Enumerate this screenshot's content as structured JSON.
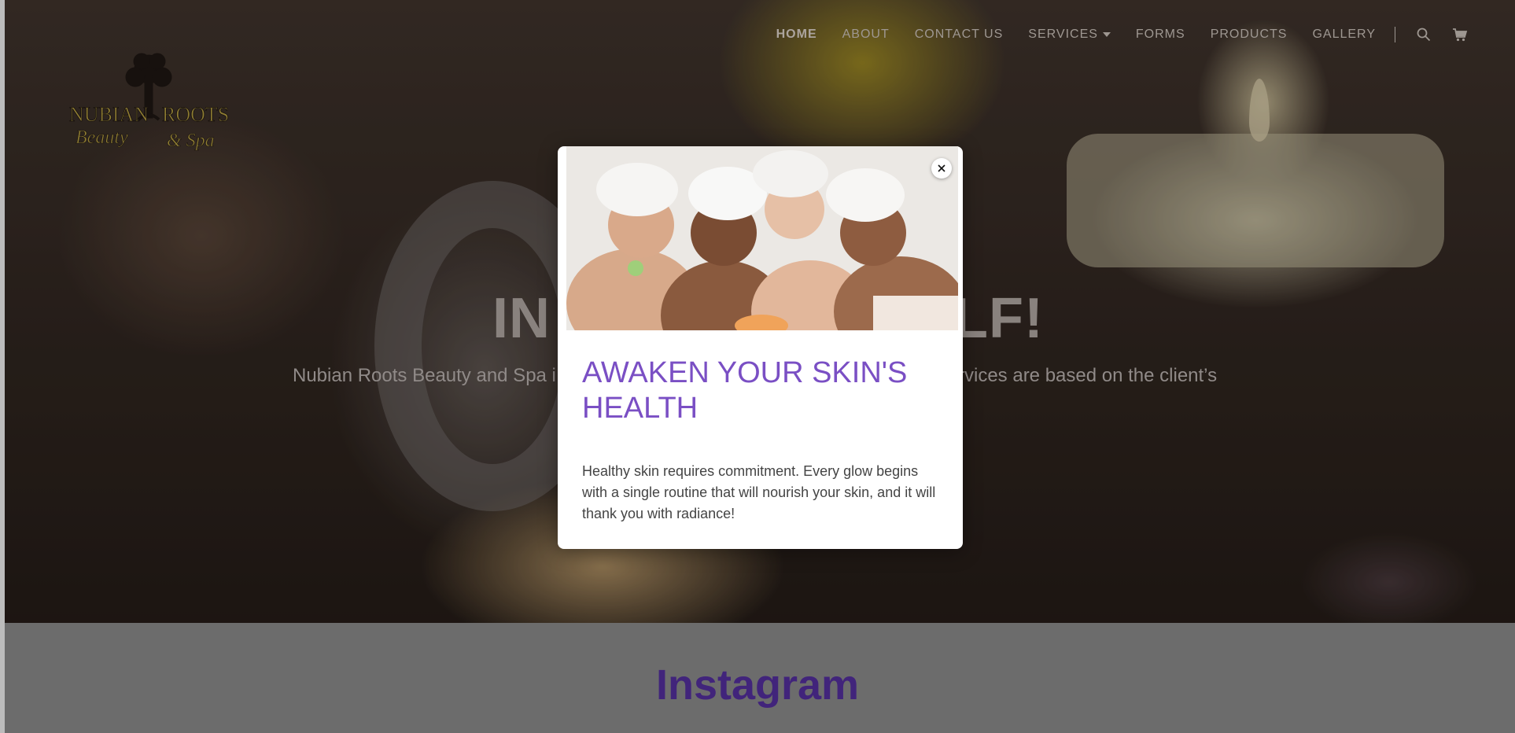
{
  "nav": {
    "items": [
      {
        "label": "HOME",
        "active": true
      },
      {
        "label": "ABOUT"
      },
      {
        "label": "CONTACT US"
      },
      {
        "label": "SERVICES",
        "dropdown": true
      },
      {
        "label": "FORMS"
      },
      {
        "label": "PRODUCTS"
      },
      {
        "label": "GALLERY"
      }
    ],
    "search_icon": "search-icon",
    "cart_icon": "cart-icon"
  },
  "logo": {
    "line1_left": "NUBIAN",
    "line1_right": "ROOTS",
    "line2_left": "Beauty",
    "line2_right": "& Spa"
  },
  "hero": {
    "title_left": "IN",
    "title_right": "LF!",
    "subtitle_left": "Nubian Roots Beauty and Spa i",
    "subtitle_right": "rvices are based on the client’s"
  },
  "instagram": {
    "title": "Instagram"
  },
  "modal": {
    "heading": "AWAKEN YOUR SKIN'S HEALTH",
    "body": "Healthy skin requires commitment. Every glow begins with a single routine that will nourish your skin, and it will thank you with radiance!",
    "close_icon": "close-icon"
  },
  "colors": {
    "accent_purple": "#7a4fc4",
    "instagram_purple": "#4b2a8c",
    "nav_text": "#b4aca6"
  }
}
